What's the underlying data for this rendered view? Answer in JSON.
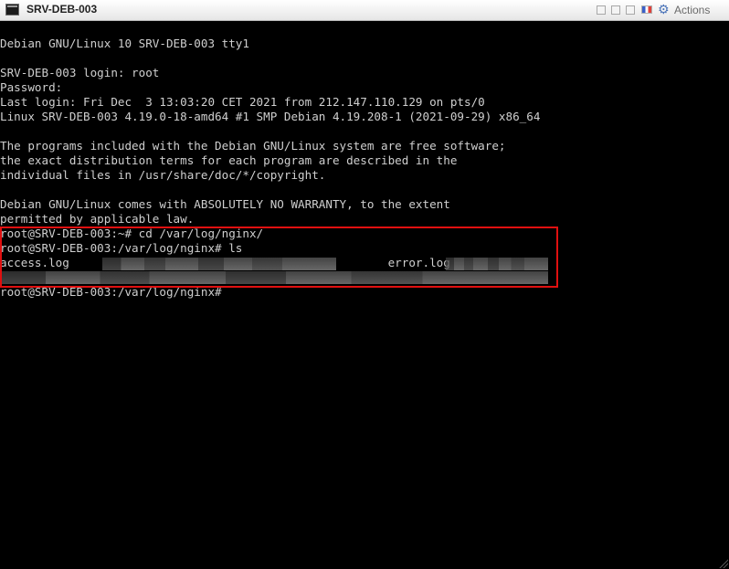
{
  "window": {
    "title": "SRV-DEB-003",
    "actions_label": "Actions",
    "icons": [
      "console-icon",
      "minimize-icon",
      "restore-icon",
      "maximize-icon",
      "flag-icon",
      "gear-icon"
    ]
  },
  "terminal": {
    "lines": [
      "Debian GNU/Linux 10 SRV-DEB-003 tty1",
      "",
      "SRV-DEB-003 login: root",
      "Password:",
      "Last login: Fri Dec  3 13:03:20 CET 2021 from 212.147.110.129 on pts/0",
      "Linux SRV-DEB-003 4.19.0-18-amd64 #1 SMP Debian 4.19.208-1 (2021-09-29) x86_64",
      "",
      "The programs included with the Debian GNU/Linux system are free software;",
      "the exact distribution terms for each program are described in the",
      "individual files in /usr/share/doc/*/copyright.",
      "",
      "Debian GNU/Linux comes with ABSOLUTELY NO WARRANTY, to the extent",
      "permitted by applicable law.",
      "root@SRV-DEB-003:~# cd /var/log/nginx/",
      "root@SRV-DEB-003:/var/log/nginx# ls",
      "access.log                                              error.log",
      "",
      "root@SRV-DEB-003:/var/log/nginx#"
    ]
  },
  "colors": {
    "terminal_bg": "#000000",
    "terminal_fg": "#cfcfcf",
    "highlight": "#e01010"
  }
}
